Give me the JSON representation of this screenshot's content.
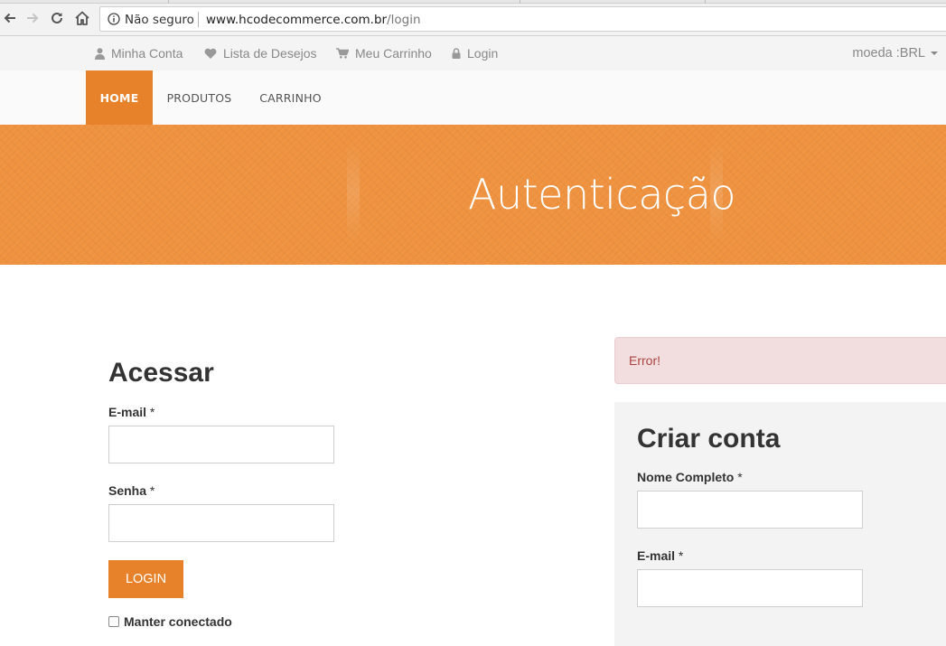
{
  "browser": {
    "security_label": "Não seguro",
    "url_host": "www.hcodecommerce.com.br",
    "url_path": "/login"
  },
  "topbar": {
    "links": [
      {
        "label": "Minha Conta",
        "icon": "user-icon"
      },
      {
        "label": "Lista de Desejos",
        "icon": "heart-icon"
      },
      {
        "label": "Meu Carrinho",
        "icon": "cart-icon"
      },
      {
        "label": "Login",
        "icon": "lock-icon"
      }
    ],
    "currency_label": "moeda :BRL"
  },
  "mainnav": {
    "items": [
      {
        "label": "HOME",
        "active": true
      },
      {
        "label": "PRODUTOS",
        "active": false
      },
      {
        "label": "CARRINHO",
        "active": false
      }
    ]
  },
  "banner": {
    "title": "Autenticação"
  },
  "login": {
    "title": "Acessar",
    "email_label": "E-mail",
    "password_label": "Senha",
    "required_mark": "*",
    "button_label": "LOGIN",
    "remember_label": "Manter conectado",
    "email_value": "",
    "password_value": ""
  },
  "alert": {
    "message": "Error!"
  },
  "register": {
    "title": "Criar conta",
    "name_label": "Nome Completo",
    "email_label": "E-mail",
    "required_mark": "*",
    "name_value": "",
    "email_value": ""
  },
  "colors": {
    "accent": "#e8822a",
    "banner": "#ee923f",
    "alert_bg": "#f2dede",
    "alert_text": "#a94442"
  }
}
